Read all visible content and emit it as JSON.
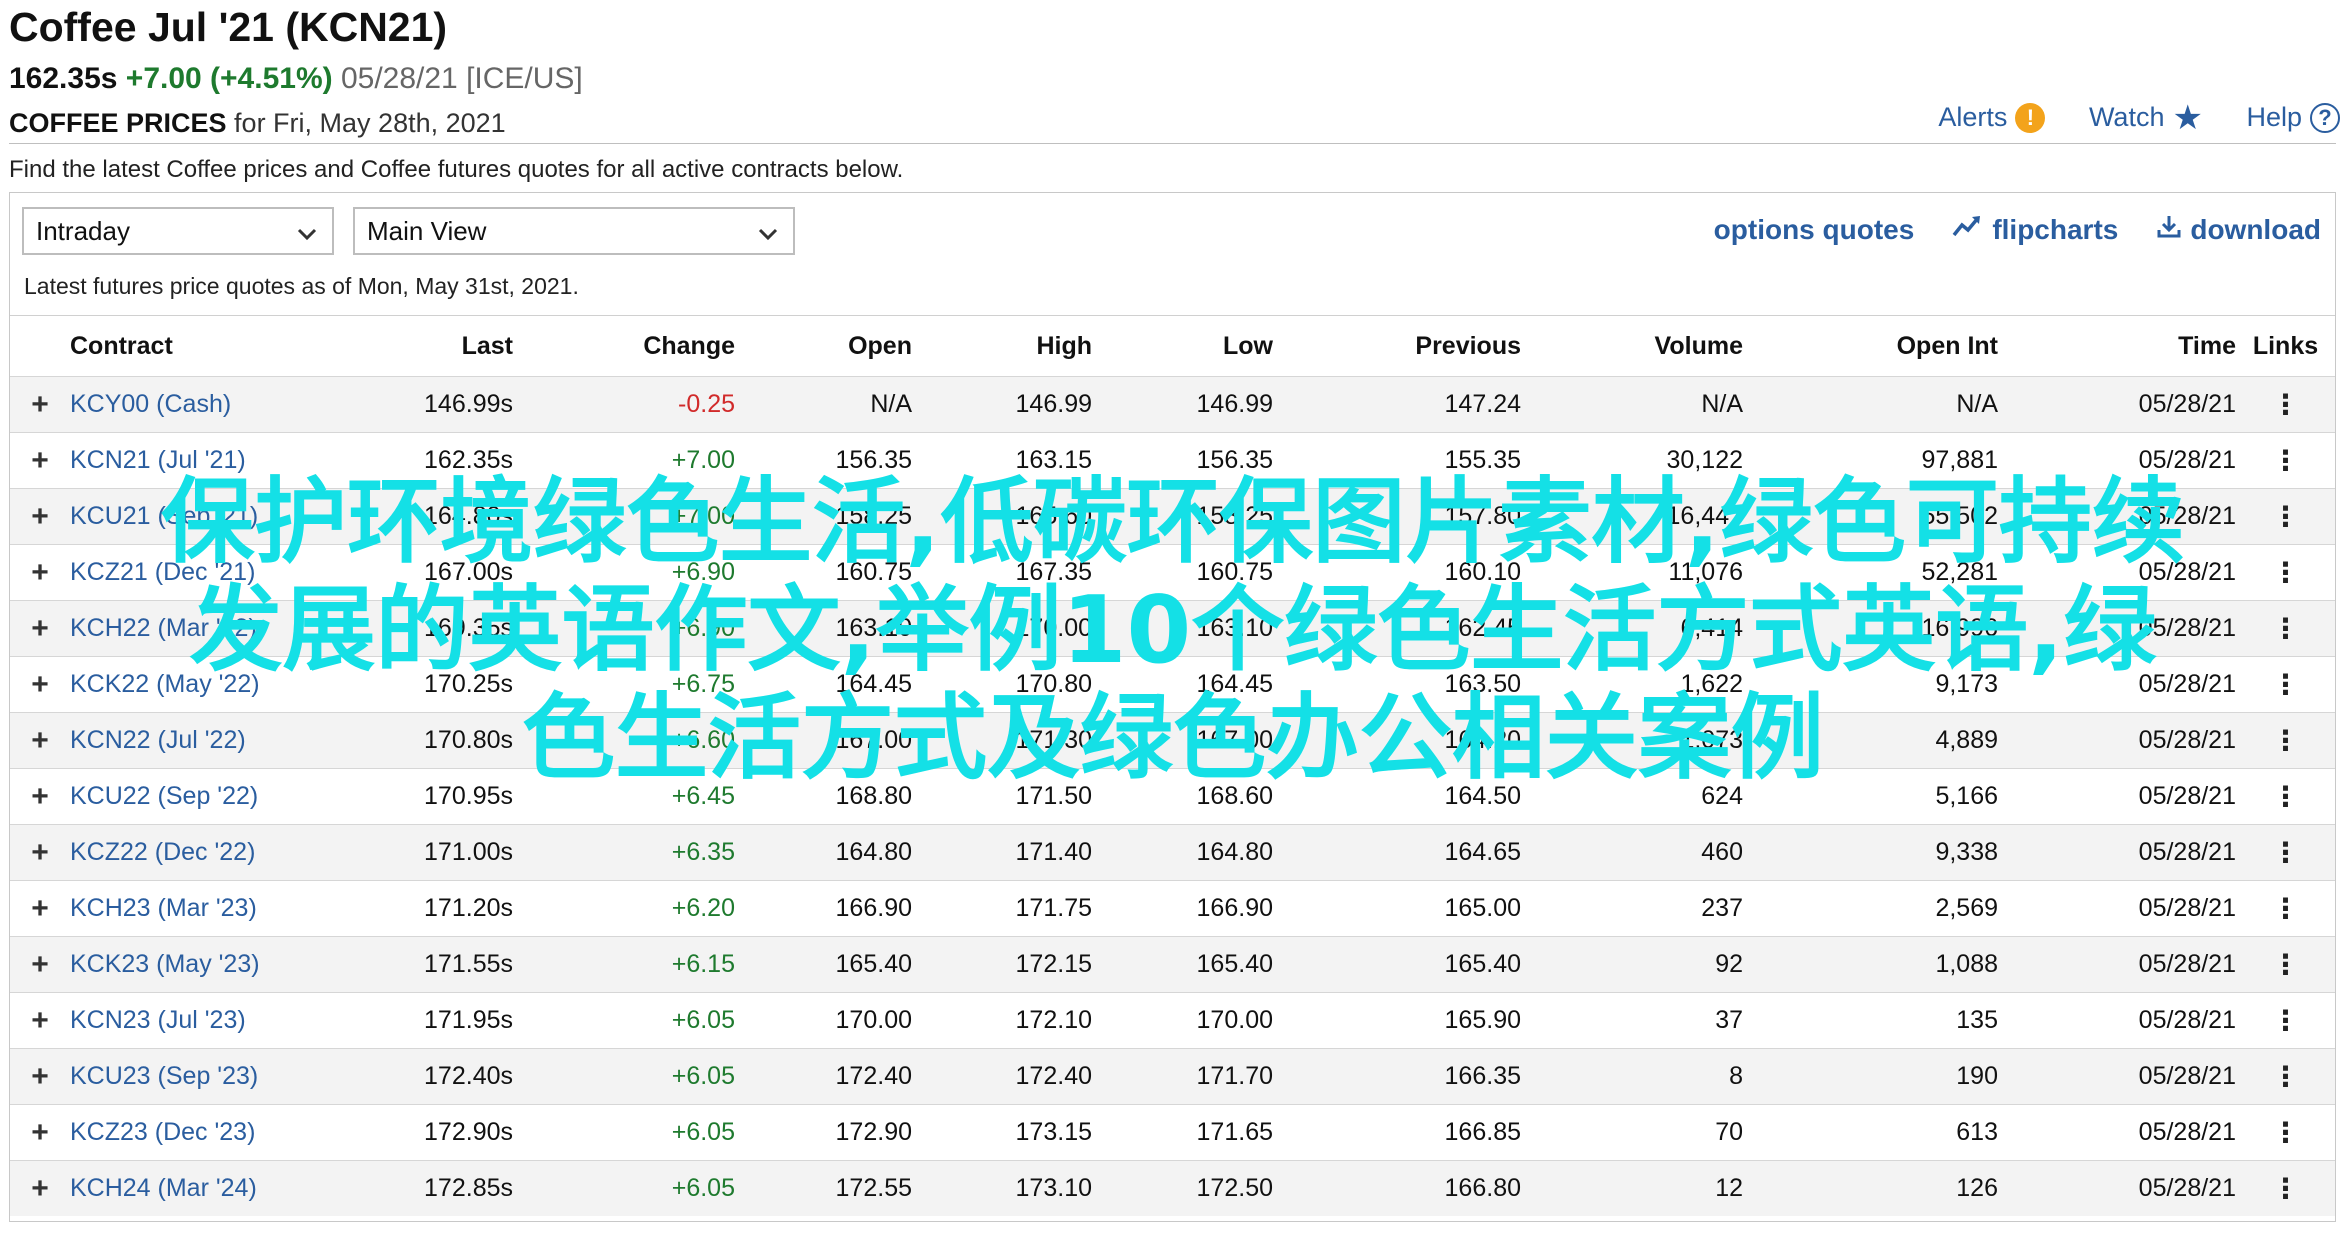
{
  "header": {
    "title": "Coffee Jul '21 (KCN21)",
    "last": "162.35s",
    "change": "+7.00 (+4.51%)",
    "date_exchange": "05/28/21 [ICE/US]",
    "prices_label": "COFFEE PRICES",
    "prices_for": "for Fri, May 28th, 2021"
  },
  "tools": {
    "alerts": "Alerts",
    "watch": "Watch",
    "help": "Help"
  },
  "description": "Find the latest Coffee prices and Coffee futures quotes for all active contracts below.",
  "filters": {
    "period": "Intraday",
    "view": "Main View"
  },
  "actions": {
    "options": "options quotes",
    "flipcharts": "flipcharts",
    "download": "download"
  },
  "as_of": "Latest futures price quotes as of Mon, May 31st, 2021.",
  "table": {
    "headers": [
      "Contract",
      "Last",
      "Change",
      "Open",
      "High",
      "Low",
      "Previous",
      "Volume",
      "Open Int",
      "Time",
      "Links"
    ],
    "rows": [
      {
        "contract": "KCY00 (Cash)",
        "last": "146.99s",
        "change": "-0.25",
        "open": "N/A",
        "high": "146.99",
        "low": "146.99",
        "previous": "147.24",
        "volume": "N/A",
        "open_int": "N/A",
        "time": "05/28/21"
      },
      {
        "contract": "KCN21 (Jul '21)",
        "last": "162.35s",
        "change": "+7.00",
        "open": "156.35",
        "high": "163.15",
        "low": "156.35",
        "previous": "155.35",
        "volume": "30,122",
        "open_int": "97,881",
        "time": "05/28/21"
      },
      {
        "contract": "KCU21 (Sep '21)",
        "last": "164.80s",
        "change": "+7.00",
        "open": "158.25",
        "high": "165.60",
        "low": "158.25",
        "previous": "157.80",
        "volume": "16,447",
        "open_int": "55,502",
        "time": "05/28/21"
      },
      {
        "contract": "KCZ21 (Dec '21)",
        "last": "167.00s",
        "change": "+6.90",
        "open": "160.75",
        "high": "167.35",
        "low": "160.75",
        "previous": "160.10",
        "volume": "11,076",
        "open_int": "52,281",
        "time": "05/28/21"
      },
      {
        "contract": "KCH22 (Mar '22)",
        "last": "169.35s",
        "change": "+6.90",
        "open": "163.10",
        "high": "170.00",
        "low": "163.10",
        "previous": "162.45",
        "volume": "6,414",
        "open_int": "16,996",
        "time": "05/28/21"
      },
      {
        "contract": "KCK22 (May '22)",
        "last": "170.25s",
        "change": "+6.75",
        "open": "164.45",
        "high": "170.80",
        "low": "164.45",
        "previous": "163.50",
        "volume": "1,622",
        "open_int": "9,173",
        "time": "05/28/21"
      },
      {
        "contract": "KCN22 (Jul '22)",
        "last": "170.80s",
        "change": "+6.60",
        "open": "167.00",
        "high": "171.30",
        "low": "167.00",
        "previous": "164.20",
        "volume": "1,073",
        "open_int": "4,889",
        "time": "05/28/21"
      },
      {
        "contract": "KCU22 (Sep '22)",
        "last": "170.95s",
        "change": "+6.45",
        "open": "168.80",
        "high": "171.50",
        "low": "168.60",
        "previous": "164.50",
        "volume": "624",
        "open_int": "5,166",
        "time": "05/28/21"
      },
      {
        "contract": "KCZ22 (Dec '22)",
        "last": "171.00s",
        "change": "+6.35",
        "open": "164.80",
        "high": "171.40",
        "low": "164.80",
        "previous": "164.65",
        "volume": "460",
        "open_int": "9,338",
        "time": "05/28/21"
      },
      {
        "contract": "KCH23 (Mar '23)",
        "last": "171.20s",
        "change": "+6.20",
        "open": "166.90",
        "high": "171.75",
        "low": "166.90",
        "previous": "165.00",
        "volume": "237",
        "open_int": "2,569",
        "time": "05/28/21"
      },
      {
        "contract": "KCK23 (May '23)",
        "last": "171.55s",
        "change": "+6.15",
        "open": "165.40",
        "high": "172.15",
        "low": "165.40",
        "previous": "165.40",
        "volume": "92",
        "open_int": "1,088",
        "time": "05/28/21"
      },
      {
        "contract": "KCN23 (Jul '23)",
        "last": "171.95s",
        "change": "+6.05",
        "open": "170.00",
        "high": "172.10",
        "low": "170.00",
        "previous": "165.90",
        "volume": "37",
        "open_int": "135",
        "time": "05/28/21"
      },
      {
        "contract": "KCU23 (Sep '23)",
        "last": "172.40s",
        "change": "+6.05",
        "open": "172.40",
        "high": "172.40",
        "low": "171.70",
        "previous": "166.35",
        "volume": "8",
        "open_int": "190",
        "time": "05/28/21"
      },
      {
        "contract": "KCZ23 (Dec '23)",
        "last": "172.90s",
        "change": "+6.05",
        "open": "172.90",
        "high": "173.15",
        "low": "171.65",
        "previous": "166.85",
        "volume": "70",
        "open_int": "613",
        "time": "05/28/21"
      },
      {
        "contract": "KCH24 (Mar '24)",
        "last": "172.85s",
        "change": "+6.05",
        "open": "172.55",
        "high": "173.10",
        "low": "172.50",
        "previous": "166.80",
        "volume": "12",
        "open_int": "126",
        "time": "05/28/21"
      }
    ]
  },
  "watermark": {
    "line1": "保护环境绿色生活,低碳环保图片素材,绿色可持续",
    "line2": "发展的英语作文,举例10个绿色生活方式英语,绿",
    "line3": "色生活方式及绿色办公相关案例"
  },
  "colors": {
    "link": "#2a5d9f",
    "positive": "#1e7a2e",
    "negative": "#d12a2a",
    "alert": "#f3a31b",
    "watermark": "#14e0e6"
  },
  "icons": [
    "alert-icon",
    "star-icon",
    "help-icon",
    "chevron-down-icon",
    "flipcharts-icon",
    "download-icon",
    "plus-icon",
    "kebab-icon"
  ]
}
